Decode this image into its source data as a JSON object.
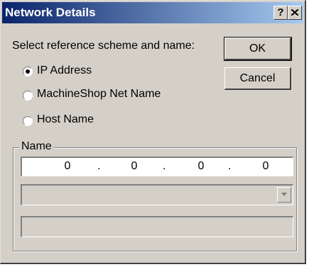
{
  "window": {
    "title": "Network Details",
    "help_label": "?",
    "close_label": "X"
  },
  "prompt": "Select reference scheme and name:",
  "buttons": {
    "ok": "OK",
    "cancel": "Cancel"
  },
  "radios": [
    {
      "label": "IP Address",
      "selected": true
    },
    {
      "label": "MachineShop Net Name",
      "selected": false
    },
    {
      "label": "Host Name",
      "selected": false
    }
  ],
  "name_group": {
    "title": "Name",
    "ip_octets": [
      "0",
      "0",
      "0",
      "0"
    ],
    "combo_value": "",
    "text_value": ""
  }
}
